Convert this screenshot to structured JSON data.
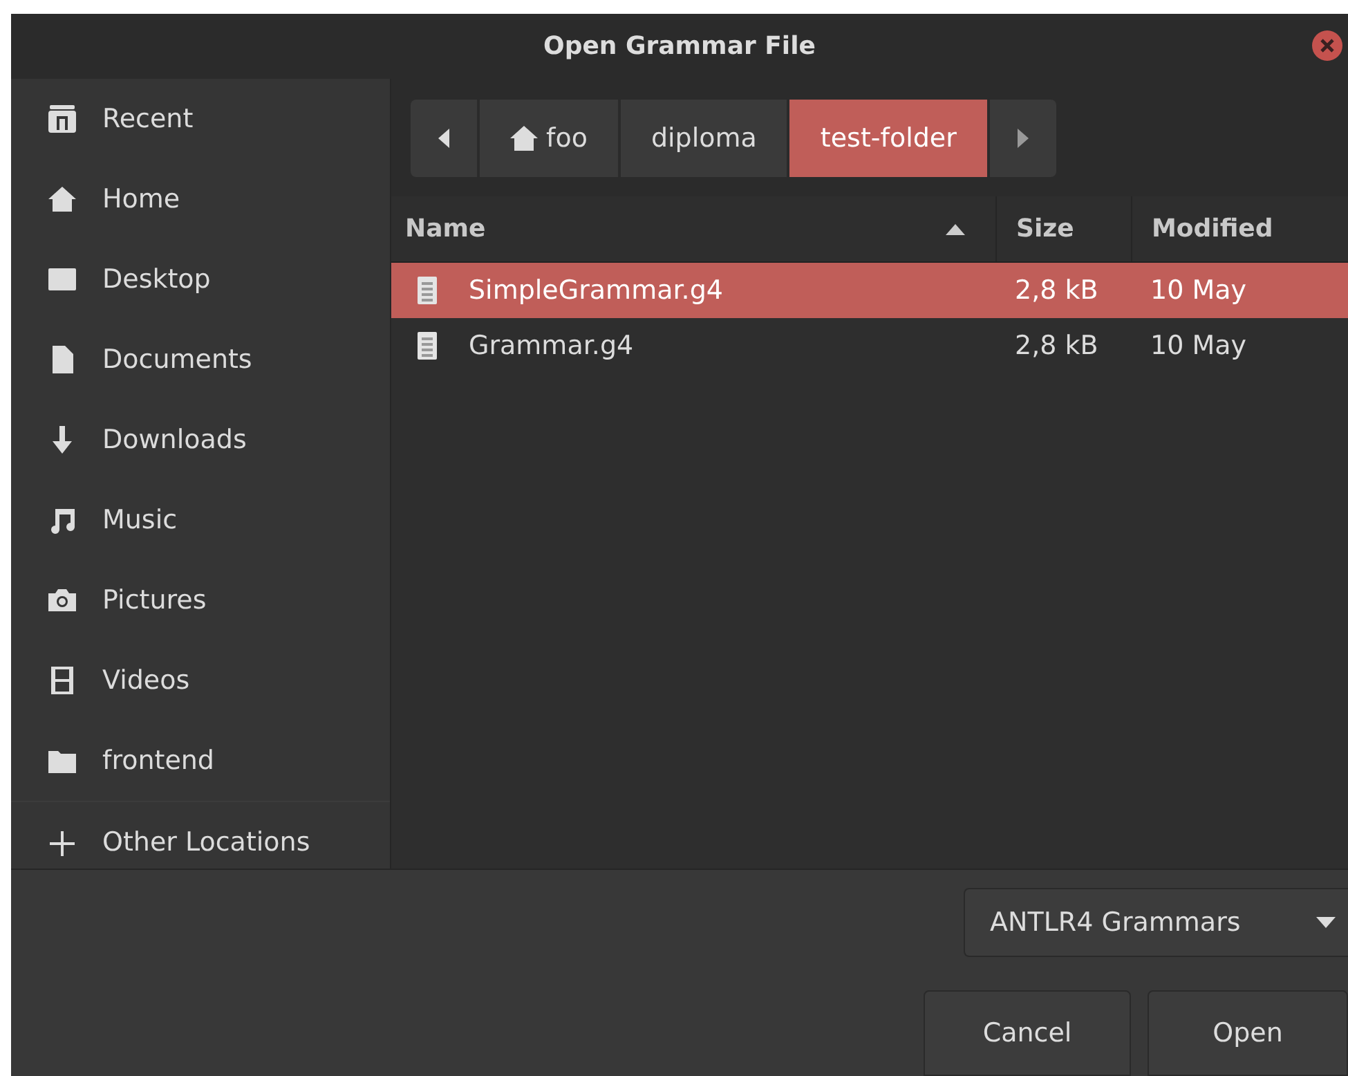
{
  "window": {
    "title": "Open Grammar File"
  },
  "sidebar": {
    "items": [
      {
        "label": "Recent"
      },
      {
        "label": "Home"
      },
      {
        "label": "Desktop"
      },
      {
        "label": "Documents"
      },
      {
        "label": "Downloads"
      },
      {
        "label": "Music"
      },
      {
        "label": "Pictures"
      },
      {
        "label": "Videos"
      },
      {
        "label": "frontend"
      },
      {
        "label": "Other Locations"
      }
    ]
  },
  "path_bar": {
    "segments": [
      {
        "label": "foo",
        "selected": false
      },
      {
        "label": "diploma",
        "selected": false
      },
      {
        "label": "test-folder",
        "selected": true
      }
    ]
  },
  "table": {
    "columns": [
      "Name",
      "Size",
      "Modified"
    ],
    "rows": [
      {
        "name": "SimpleGrammar.g4",
        "size": "2,8 kB",
        "modified": "10 May",
        "selected": true
      },
      {
        "name": "Grammar.g4",
        "size": "2,8 kB",
        "modified": "10 May",
        "selected": false
      }
    ]
  },
  "filter": {
    "value": "ANTLR4 Grammars"
  },
  "buttons": [
    "Cancel",
    "Open"
  ]
}
